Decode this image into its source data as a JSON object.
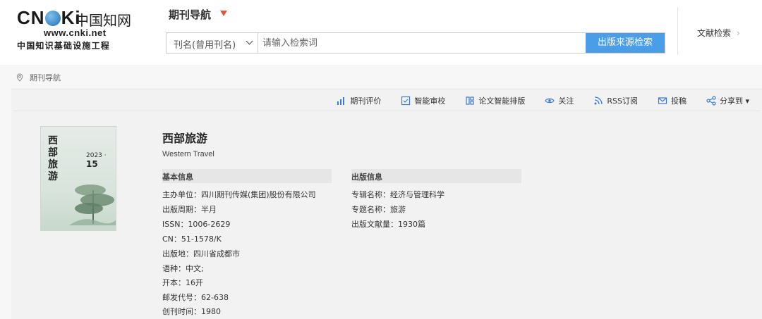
{
  "logo": {
    "brand_prefix": "CN",
    "brand_suffix": "Ki",
    "cn_name": "中国知网",
    "url": "www.cnki.net",
    "tagline": "中国知识基础设施工程"
  },
  "header": {
    "nav_title": "期刊导航",
    "search": {
      "field_option": "刊名(曾用刊名)",
      "placeholder": "请输入检索词",
      "button_label": "出版来源检索"
    },
    "doc_search_label": "文献检索",
    "doc_search_arrow": "›"
  },
  "breadcrumb": {
    "label": "期刊导航"
  },
  "toolbar": {
    "items": [
      {
        "label": "期刊评价",
        "icon": "bar-chart-icon"
      },
      {
        "label": "智能审校",
        "icon": "proofread-icon"
      },
      {
        "label": "论文智能排版",
        "icon": "layout-icon"
      },
      {
        "label": "关注",
        "icon": "eye-icon"
      },
      {
        "label": "RSS订阅",
        "icon": "rss-icon"
      },
      {
        "label": "投稿",
        "icon": "mail-icon"
      },
      {
        "label": "分享到 ▾",
        "icon": "share-icon"
      }
    ]
  },
  "journal": {
    "title": "西部旅游",
    "subtitle": "Western Travel",
    "cover": {
      "title_chars": "西部旅游",
      "year": "2023",
      "issue": "15"
    },
    "basic": {
      "heading": "基本信息",
      "fields": [
        "主办单位：四川期刊传媒(集团)股份有限公司",
        "出版周期：半月",
        "ISSN：1006-2629",
        "CN：51-1578/K",
        "出版地：四川省成都市",
        "语种：中文;",
        "开本：16开",
        "邮发代号：62-638",
        "创刊时间：1980"
      ]
    },
    "publish": {
      "heading": "出版信息",
      "fields": [
        "专辑名称：经济与管理科学",
        "专题名称：旅游",
        "出版文献量：1930篇"
      ]
    }
  }
}
